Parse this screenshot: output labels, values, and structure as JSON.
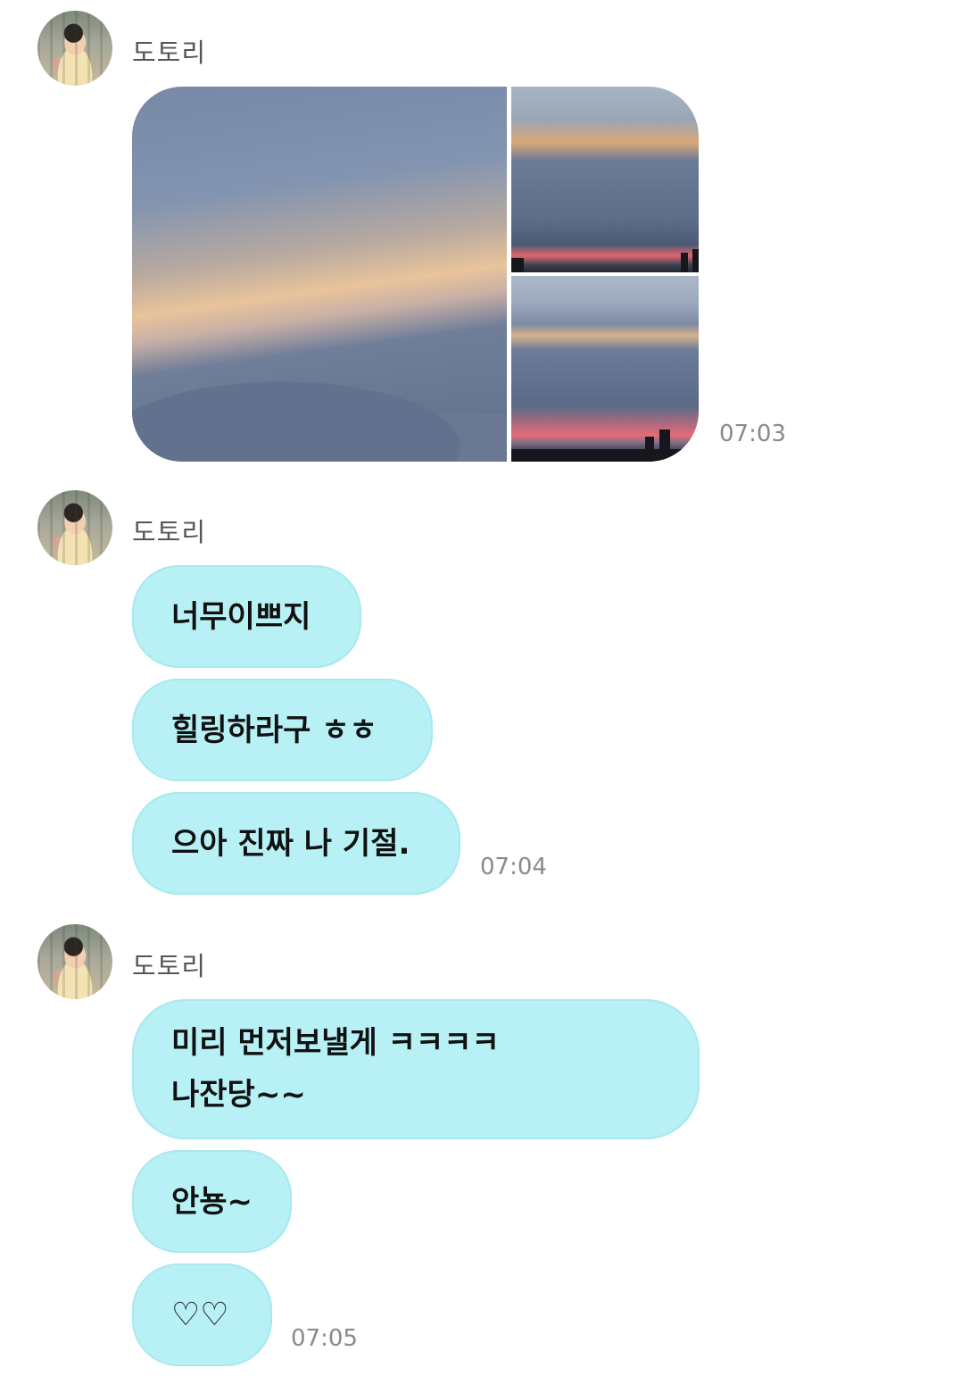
{
  "groups": [
    {
      "sender": "도토리",
      "time": "07:03"
    },
    {
      "sender": "도토리",
      "messages": [
        "너무이쁘지",
        "힐링하라구 ㅎㅎ",
        "으아 진짜 나 기절."
      ],
      "time": "07:04"
    },
    {
      "sender": "도토리",
      "messages": [
        "미리 먼저보낼게 ㅋㅋㅋㅋ",
        "나잔당~~",
        "안뇽~",
        "♡♡"
      ],
      "time": "07:05"
    }
  ],
  "colors": {
    "bubble": "#b7f1f5",
    "timestamp": "#8a8a8a",
    "sender": "#555555"
  }
}
